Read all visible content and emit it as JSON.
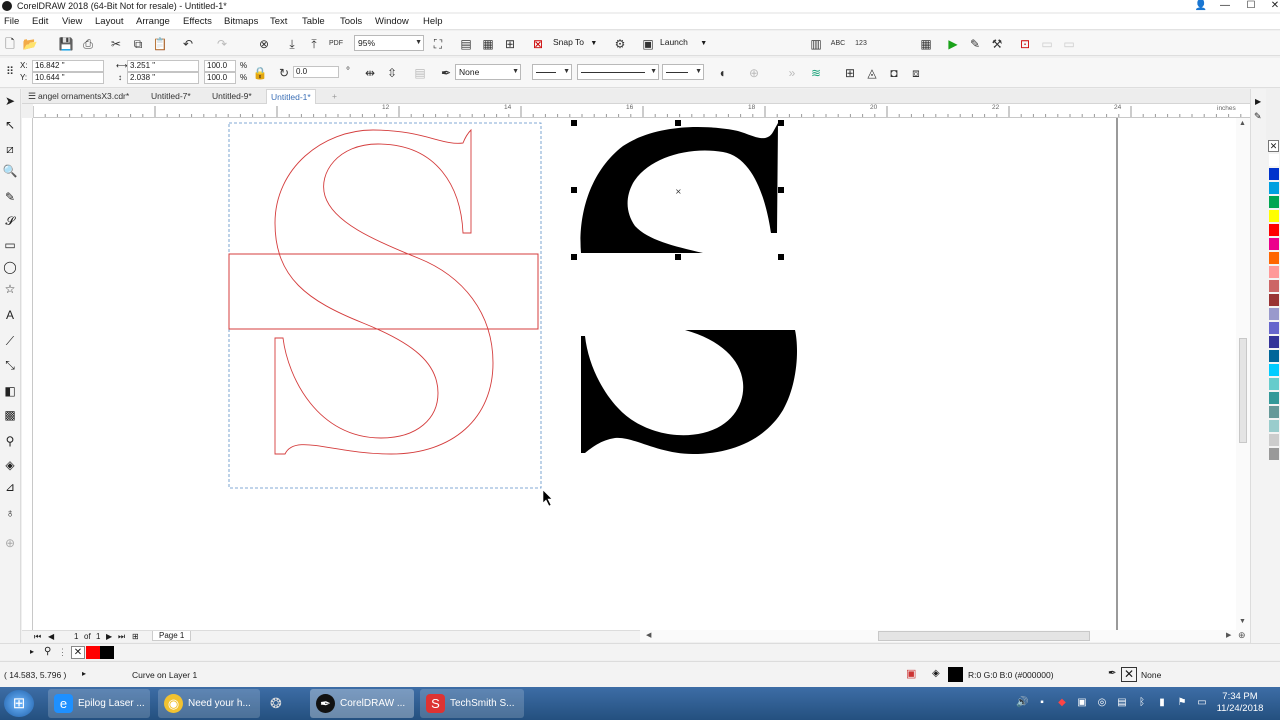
{
  "window": {
    "title": "CorelDRAW 2018 (64-Bit Not for resale) - Untitled-1*",
    "minimize": "—",
    "maximize": "☐",
    "close": "✕"
  },
  "menu": [
    "File",
    "Edit",
    "View",
    "Layout",
    "Arrange",
    "Effects",
    "Bitmaps",
    "Text",
    "Table",
    "Tools",
    "Window",
    "Help"
  ],
  "toolbar": {
    "zoom_value": "95%",
    "snap_label": "Snap To",
    "launch_label": "Launch"
  },
  "propbar": {
    "x_label": "X:",
    "x_value": "16.842 \"",
    "y_label": "Y:",
    "y_value": "10.644 \"",
    "w_value": "3.251 \"",
    "h_value": "2.038 \"",
    "scale_w": "100.0",
    "scale_h": "100.0",
    "percent": "%",
    "angle": "0.0",
    "outline": "None"
  },
  "tabs": [
    {
      "label": "angel ornamentsX3.cdr*",
      "active": false
    },
    {
      "label": "Untitled-7*",
      "active": false
    },
    {
      "label": "Untitled-9*",
      "active": false
    },
    {
      "label": "Untitled-1*",
      "active": true
    }
  ],
  "ruler": {
    "ticks": [
      "12",
      "14",
      "16",
      "18",
      "20",
      "22",
      "24"
    ],
    "unit": "inches"
  },
  "pagenav": {
    "current": "1",
    "of": "of",
    "total": "1",
    "page_tab": "Page 1"
  },
  "status": {
    "coords": "( 14.583, 5.796 )",
    "object_info": "Curve on Layer 1",
    "fill_info": "R:0 G:0 B:0 (#000000)",
    "outline_info": "None"
  },
  "palette_colors": [
    "#ffffff",
    "#0033cc",
    "#00a0e0",
    "#00a651",
    "#ffff00",
    "#ff0000",
    "#ec008c",
    "#ff6600",
    "#ff9999",
    "#cc6666",
    "#993333",
    "#9999cc",
    "#6666cc",
    "#333399",
    "#006699",
    "#00ccff",
    "#66cccc",
    "#339999",
    "#669999",
    "#99cccc",
    "#cccccc",
    "#999999"
  ],
  "taskbar": {
    "items": [
      "Epilog Laser ...",
      "Need your h...",
      "CorelDRAW ...",
      "TechSmith S..."
    ],
    "time": "7:34 PM",
    "date": "11/24/2018"
  }
}
